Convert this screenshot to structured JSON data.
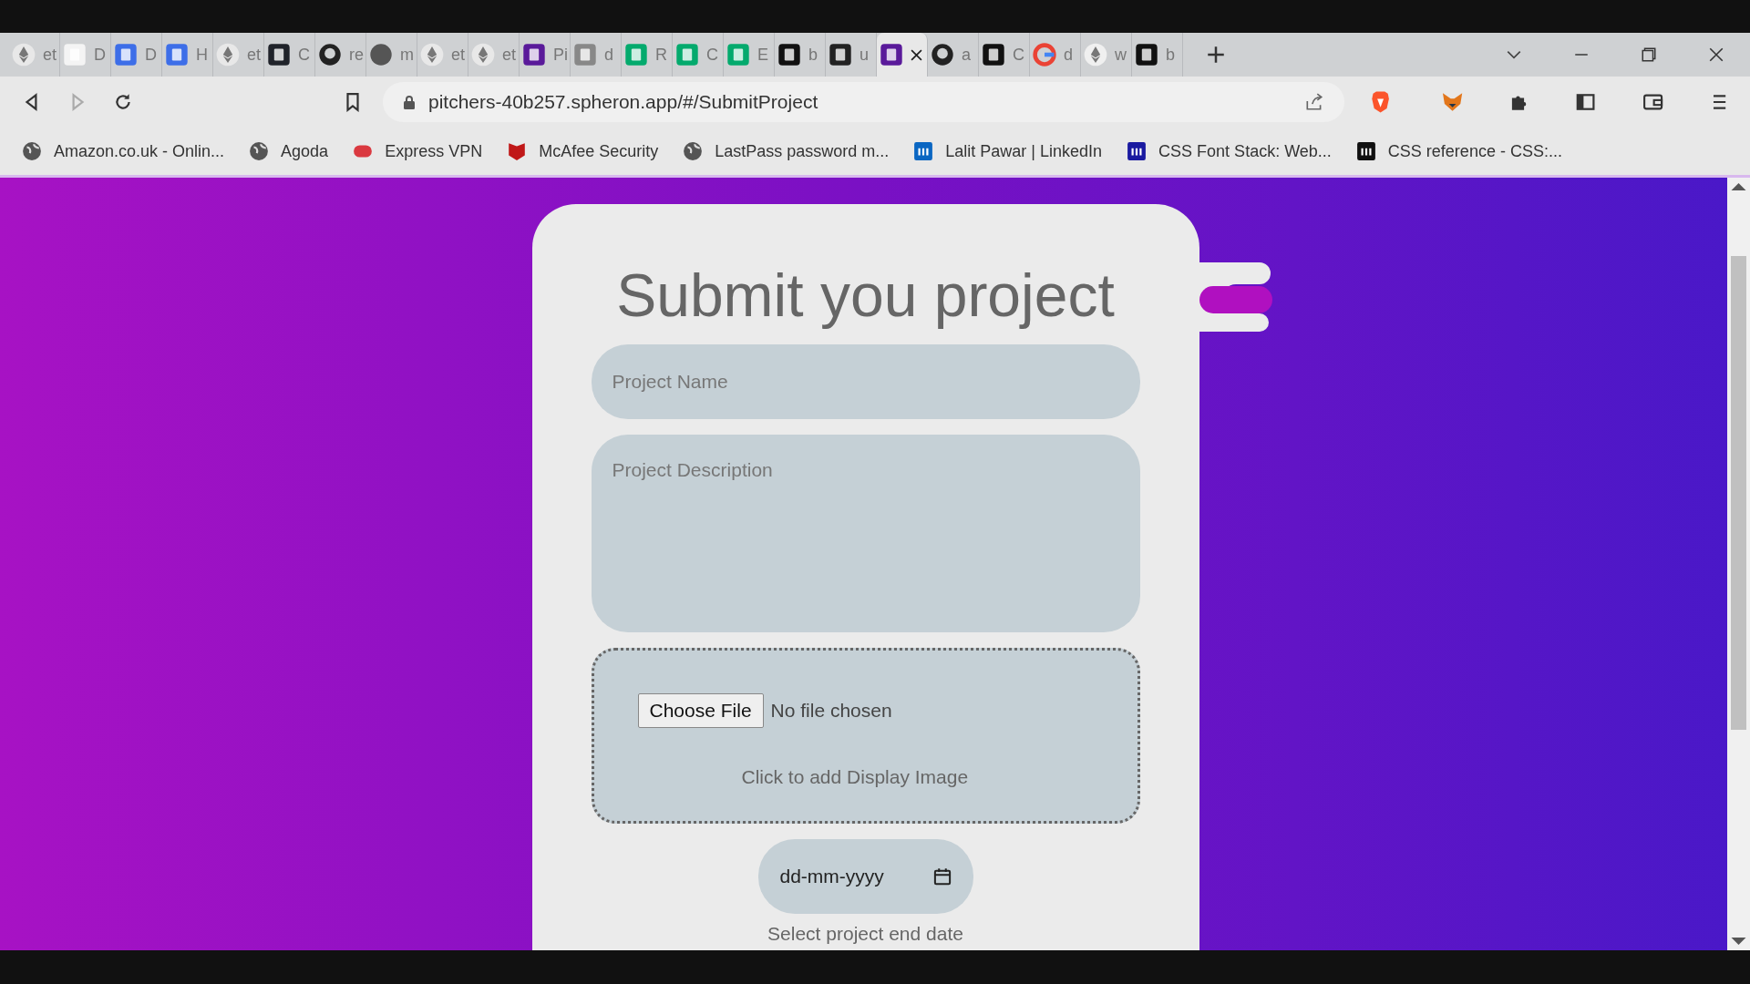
{
  "tabs": [
    {
      "kind": "eth",
      "title": "et",
      "selected": false
    },
    {
      "kind": "h2s",
      "title": "D",
      "selected": false
    },
    {
      "kind": "blued",
      "title": "D",
      "selected": false
    },
    {
      "kind": "diamond",
      "title": "H",
      "selected": false
    },
    {
      "kind": "eth",
      "title": "et",
      "selected": false
    },
    {
      "kind": "react",
      "title": "C",
      "selected": false
    },
    {
      "kind": "github",
      "title": "re",
      "selected": false
    },
    {
      "kind": "globe",
      "title": "m",
      "selected": false
    },
    {
      "kind": "eth",
      "title": "et",
      "selected": false
    },
    {
      "kind": "eth",
      "title": "et",
      "selected": false
    },
    {
      "kind": "purple",
      "title": "Pi",
      "selected": false
    },
    {
      "kind": "lines",
      "title": "d",
      "selected": false
    },
    {
      "kind": "w3",
      "title": "R",
      "selected": false
    },
    {
      "kind": "w3",
      "title": "C",
      "selected": false
    },
    {
      "kind": "w3",
      "title": "E",
      "selected": false
    },
    {
      "kind": "mdn",
      "title": "b",
      "selected": false
    },
    {
      "kind": "unsplash",
      "title": "u",
      "selected": false
    },
    {
      "kind": "purple",
      "selected": true
    },
    {
      "kind": "github",
      "title": "a",
      "selected": false
    },
    {
      "kind": "mdn",
      "title": "C",
      "selected": false
    },
    {
      "kind": "google",
      "title": "d",
      "selected": false
    },
    {
      "kind": "amazon",
      "title": "w",
      "selected": false
    },
    {
      "kind": "mdn",
      "title": "b",
      "selected": false
    }
  ],
  "address": "pitchers-40b257.spheron.app/#/SubmitProject",
  "bookmarks": [
    {
      "kind": "globe",
      "label": "Amazon.co.uk - Onlin..."
    },
    {
      "kind": "globe",
      "label": "Agoda"
    },
    {
      "kind": "vpn",
      "label": "Express VPN"
    },
    {
      "kind": "mcafee",
      "label": "McAfee Security"
    },
    {
      "kind": "globe",
      "label": "LastPass password m..."
    },
    {
      "kind": "linkedin",
      "label": "Lalit Pawar | LinkedIn"
    },
    {
      "kind": "dans",
      "label": "CSS Font Stack: Web..."
    },
    {
      "kind": "mdn",
      "label": "CSS reference - CSS:..."
    }
  ],
  "form": {
    "title": "Submit you project",
    "name_placeholder": "Project Name",
    "description_placeholder": "Project Description",
    "file_button": "Choose File",
    "file_status": "No file chosen",
    "image_hint": "Click to add Display Image",
    "date_placeholder": "dd-mm-yyyy",
    "date_hint": "Select project end date"
  }
}
